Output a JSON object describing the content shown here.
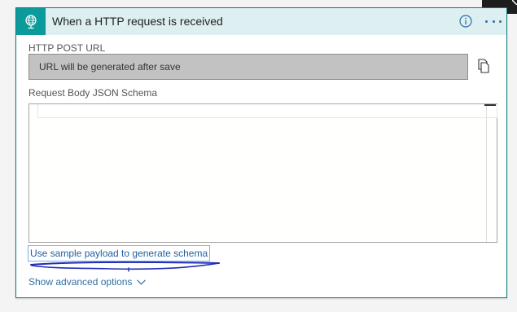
{
  "trigger": {
    "title": "When a HTTP request is received",
    "icon": "globe-icon",
    "accent_color": "#0c9b9b",
    "header_background": "#ddeff1"
  },
  "header_actions": {
    "info_icon": "info-icon",
    "more_icon": "more-options-icon"
  },
  "http_post_url": {
    "label": "HTTP POST URL",
    "value": "URL will be generated after save",
    "copy_icon": "copy-icon"
  },
  "schema": {
    "label": "Request Body JSON Schema",
    "value": ""
  },
  "sample_payload_link": "Use sample payload to generate schema",
  "advanced_options": {
    "label": "Show advanced options",
    "icon": "chevron-down-icon"
  }
}
